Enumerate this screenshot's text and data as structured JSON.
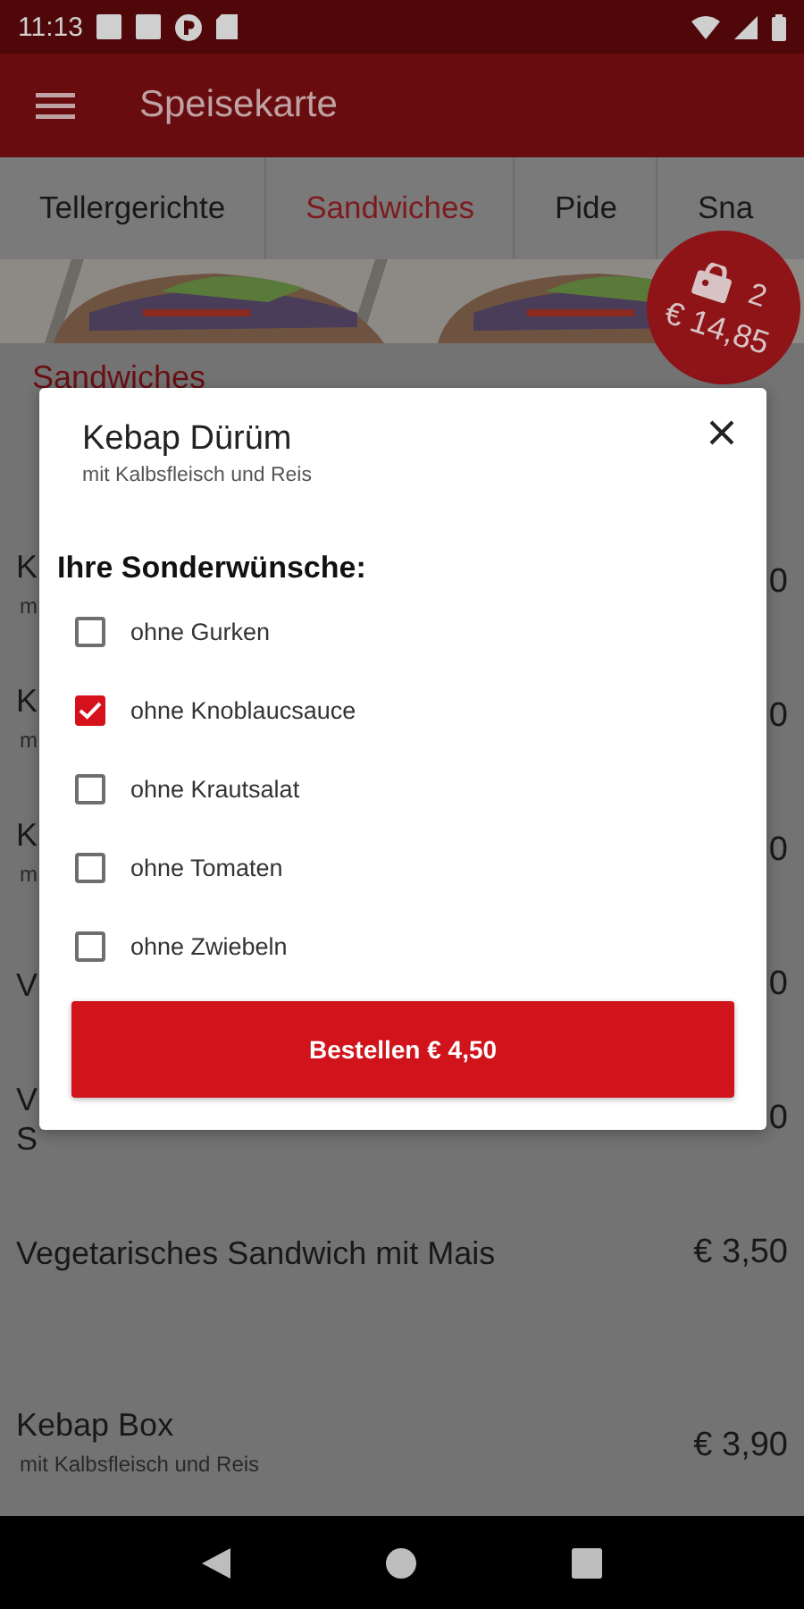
{
  "status_bar": {
    "time": "11:13"
  },
  "app_bar": {
    "title": "Speisekarte"
  },
  "tabs": [
    {
      "label": "Tellergerichte",
      "selected": false
    },
    {
      "label": "Sandwiches",
      "selected": true
    },
    {
      "label": "Pide",
      "selected": false
    },
    {
      "label": "Sna",
      "selected": false
    }
  ],
  "cart": {
    "count": "2",
    "total": "€ 14,85"
  },
  "section": {
    "title": "Sandwiches"
  },
  "menu_items": [
    {
      "name": "K",
      "sub": "m",
      "price": "0"
    },
    {
      "name": "K",
      "sub": "m",
      "price": "0"
    },
    {
      "name": "K",
      "sub": "m",
      "price": "0"
    },
    {
      "name": "V",
      "price": "0"
    },
    {
      "name": "V",
      "name_2": "S",
      "price": "0"
    },
    {
      "name": "Vegetarisches Sandwich mit Mais",
      "price": "€ 3,50"
    },
    {
      "name": "Kebap Box",
      "sub": "mit Kalbsfleisch und Reis",
      "price": "€ 3,90"
    }
  ],
  "dialog": {
    "title": "Kebap Dürüm",
    "subtitle": "mit Kalbsfleisch und Reis",
    "options_heading": "Ihre Sonderwünsche:",
    "options": [
      {
        "label": "ohne Gurken",
        "checked": false
      },
      {
        "label": "ohne Knoblaucsauce",
        "checked": true
      },
      {
        "label": "ohne Krautsalat",
        "checked": false
      },
      {
        "label": "ohne Tomaten",
        "checked": false
      },
      {
        "label": "ohne Zwiebeln",
        "checked": false
      }
    ],
    "order_button": "Bestellen € 4,50"
  }
}
